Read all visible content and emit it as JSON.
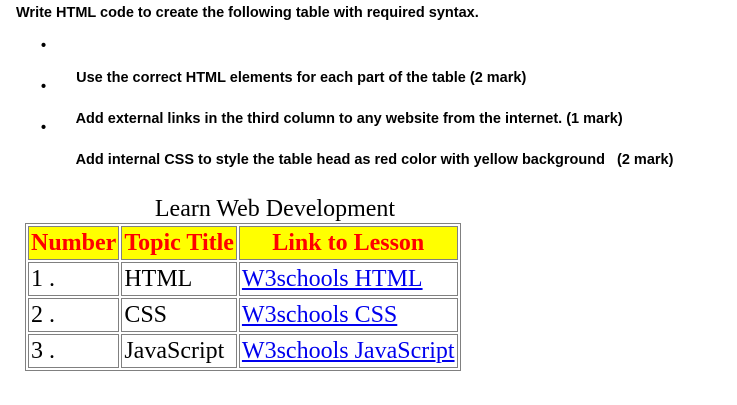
{
  "heading": "Write HTML code to create the following table with required syntax.",
  "requirements": [
    "Use the correct HTML elements for each part of the table (2 mark)",
    "Add external links in the third column to any website from the internet. (1 mark)",
    "Add internal CSS to style the table head as red color with yellow background   (2 mark)"
  ],
  "bullet_glyph": "•",
  "table": {
    "caption": "Learn Web Development",
    "headers": [
      "Number",
      "Topic Title",
      "Link to Lesson"
    ],
    "rows": [
      {
        "number": "1 .",
        "topic": "HTML",
        "link": "W3schools HTML"
      },
      {
        "number": "2 .",
        "topic": "CSS",
        "link": "W3schools CSS"
      },
      {
        "number": "3 .",
        "topic": "JavaScript",
        "link": "W3schools JavaScript"
      }
    ]
  },
  "colors": {
    "header_text": "#ff0000",
    "header_background": "#ffff00",
    "link": "#0000ee",
    "border": "#808080"
  }
}
